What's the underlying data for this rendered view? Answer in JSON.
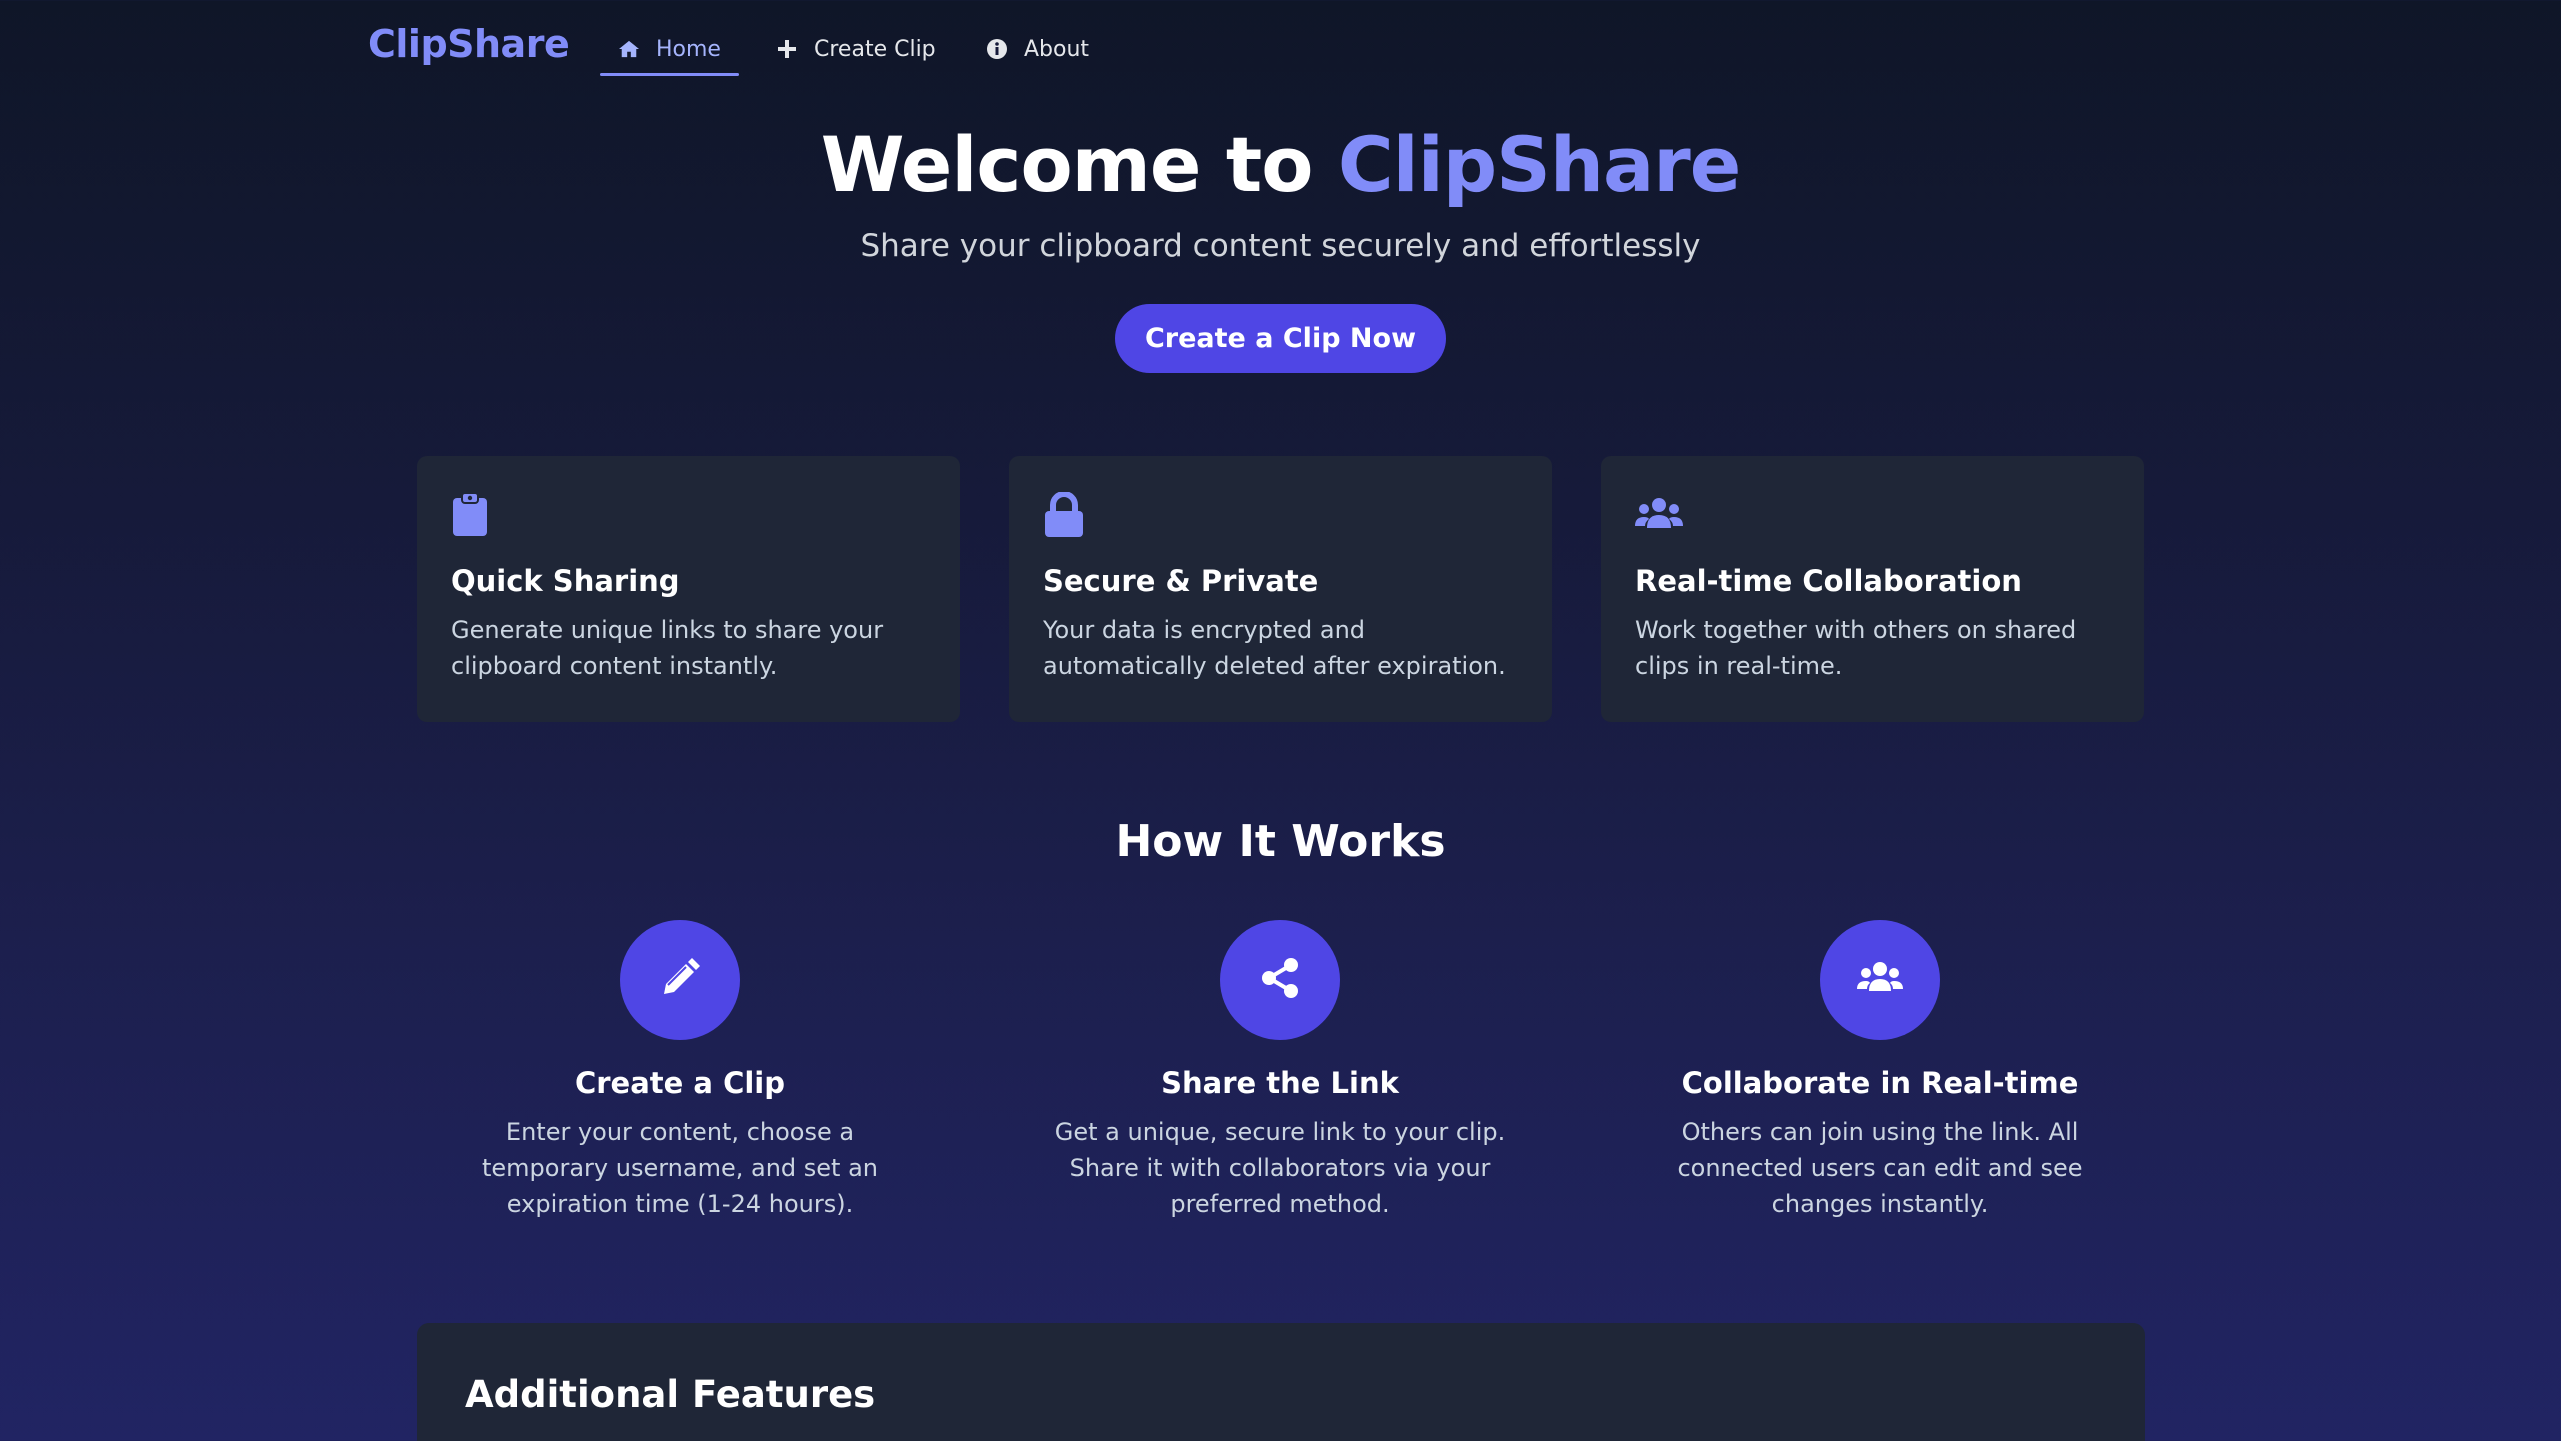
{
  "nav": {
    "brand": "ClipShare",
    "items": [
      {
        "label": "Home",
        "icon": "home-icon",
        "active": true
      },
      {
        "label": "Create Clip",
        "icon": "plus-icon",
        "active": false
      },
      {
        "label": "About",
        "icon": "info-icon",
        "active": false
      }
    ]
  },
  "hero": {
    "title_prefix": "Welcome to ",
    "title_accent": "ClipShare",
    "subtitle": "Share your clipboard content securely and effortlessly",
    "cta_label": "Create a Clip Now"
  },
  "features": [
    {
      "icon": "clipboard-icon",
      "title": "Quick Sharing",
      "text": "Generate unique links to share your clipboard content instantly."
    },
    {
      "icon": "lock-icon",
      "title": "Secure & Private",
      "text": "Your data is encrypted and automatically deleted after expiration."
    },
    {
      "icon": "users-icon",
      "title": "Real-time Collaboration",
      "text": "Work together with others on shared clips in real-time."
    }
  ],
  "how_it_works": {
    "title": "How It Works",
    "steps": [
      {
        "icon": "pencil-icon",
        "title": "Create a Clip",
        "text": "Enter your content, choose a temporary username, and set an expiration time (1-24 hours)."
      },
      {
        "icon": "share-icon",
        "title": "Share the Link",
        "text": "Get a unique, secure link to your clip. Share it with collaborators via your preferred method."
      },
      {
        "icon": "users-icon",
        "title": "Collaborate in Real-time",
        "text": "Others can join using the link. All connected users can edit and see changes instantly."
      }
    ]
  },
  "additional": {
    "title": "Additional Features"
  },
  "colors": {
    "accent": "#818cf8",
    "primary": "#4f46e5",
    "card_bg": "#1f2637"
  }
}
